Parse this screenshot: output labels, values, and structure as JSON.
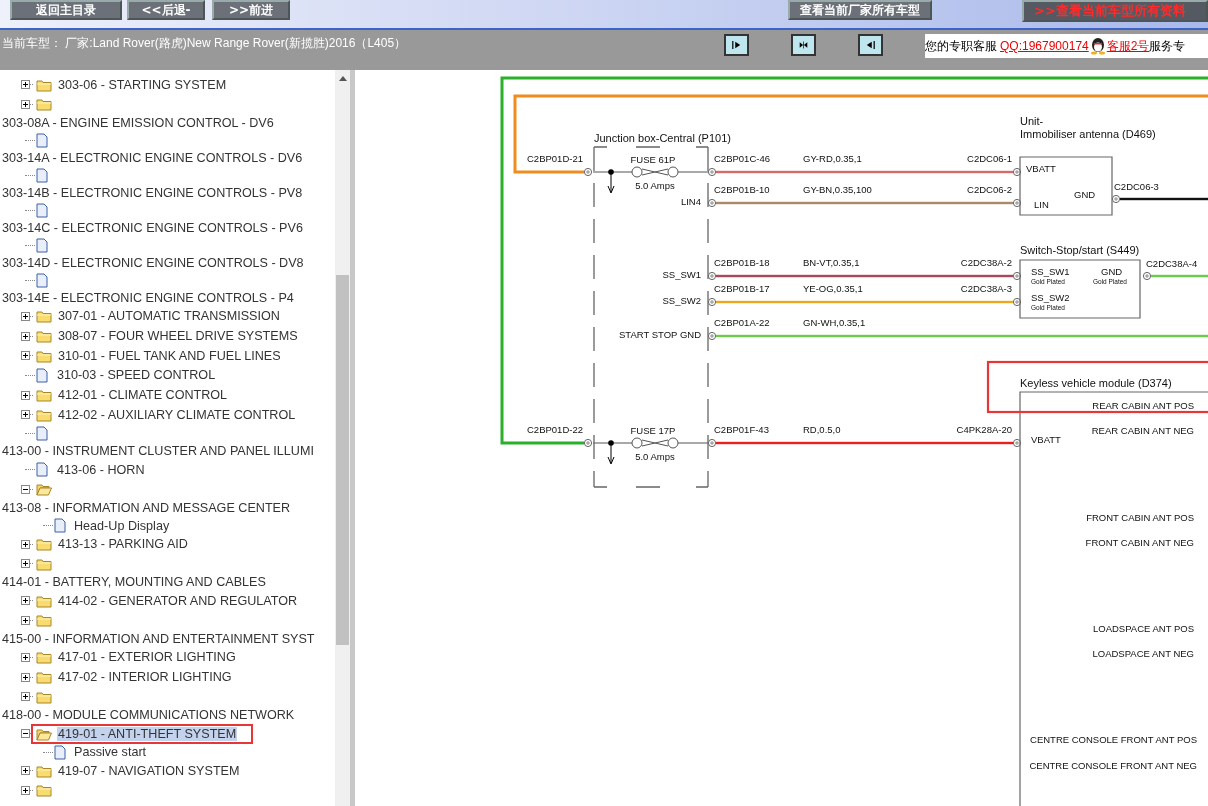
{
  "toolbar": {
    "buttons": [
      {
        "label": "返回主目录",
        "kind": "nav"
      },
      {
        "label": "<<后退-",
        "kind": "nav"
      },
      {
        "label": ">>前进",
        "kind": "nav"
      },
      {
        "label": "查看当前厂家所有车型",
        "kind": "nav"
      },
      {
        "label": ">>查看当前车型所有资料",
        "kind": "highlight"
      }
    ]
  },
  "vehicle_bar": {
    "text": "当前车型： 厂家:Land Rover(路虎)New Range Rover(新揽胜)2016（L405）"
  },
  "support": {
    "prefix": "您的专职客服",
    "qq_link": "QQ:1967900174",
    "agent_link": "客服2号",
    "suffix": "服务专"
  },
  "tree": {
    "rows": [
      {
        "kind": "folder",
        "label": "303-06 - STARTING SYSTEM",
        "expanded": false,
        "selected": false
      },
      {
        "kind": "folder",
        "expanded": false
      },
      {
        "kind": "text",
        "label": "303-08A - ENGINE EMISSION CONTROL - DV6",
        "selected": false
      },
      {
        "kind": "doc"
      },
      {
        "kind": "text",
        "label": "303-14A - ELECTRONIC ENGINE CONTROLS - DV6",
        "selected": false
      },
      {
        "kind": "doc"
      },
      {
        "kind": "text",
        "label": "303-14B - ELECTRONIC ENGINE CONTROLS - PV8",
        "selected": false
      },
      {
        "kind": "doc"
      },
      {
        "kind": "text",
        "label": "303-14C - ELECTRONIC ENGINE CONTROLS - PV6",
        "selected": false
      },
      {
        "kind": "doc"
      },
      {
        "kind": "text",
        "label": "303-14D - ELECTRONIC ENGINE CONTROLS - DV8",
        "selected": false
      },
      {
        "kind": "doc"
      },
      {
        "kind": "text",
        "label": "303-14E - ELECTRONIC ENGINE CONTROLS - P4",
        "selected": false
      },
      {
        "kind": "folder",
        "label": "307-01 - AUTOMATIC TRANSMISSION",
        "expanded": false,
        "selected": false
      },
      {
        "kind": "folder",
        "label": "308-07 - FOUR WHEEL DRIVE SYSTEMS",
        "expanded": false,
        "selected": false
      },
      {
        "kind": "folder",
        "label": "310-01 - FUEL TANK AND FUEL LINES",
        "expanded": false,
        "selected": false
      },
      {
        "kind": "doc",
        "label": "310-03 - SPEED CONTROL",
        "selected": false
      },
      {
        "kind": "folder",
        "label": "412-01 - CLIMATE CONTROL",
        "expanded": false,
        "selected": false
      },
      {
        "kind": "folder",
        "label": "412-02 - AUXILIARY CLIMATE CONTROL",
        "expanded": false,
        "selected": false
      },
      {
        "kind": "doc"
      },
      {
        "kind": "text",
        "label": "413-00 - INSTRUMENT CLUSTER AND PANEL ILLUMI",
        "selected": false
      },
      {
        "kind": "doc",
        "label": "413-06 - HORN",
        "selected": false
      },
      {
        "kind": "folder",
        "expanded": true
      },
      {
        "kind": "text",
        "label": "413-08 - INFORMATION AND MESSAGE CENTER",
        "selected": false,
        "children": [
          {
            "kind": "doc",
            "label": "Head-Up Display",
            "selected": false
          }
        ]
      },
      {
        "kind": "folder",
        "label": "413-13 - PARKING AID",
        "expanded": false,
        "selected": false
      },
      {
        "kind": "folder",
        "expanded": false
      },
      {
        "kind": "text",
        "label": "414-01 - BATTERY, MOUNTING AND CABLES",
        "selected": false
      },
      {
        "kind": "folder",
        "label": "414-02 - GENERATOR AND REGULATOR",
        "expanded": false,
        "selected": false
      },
      {
        "kind": "folder",
        "expanded": false
      },
      {
        "kind": "text",
        "label": "415-00 - INFORMATION AND ENTERTAINMENT SYST",
        "selected": false
      },
      {
        "kind": "folder",
        "label": "417-01 - EXTERIOR LIGHTING",
        "expanded": false,
        "selected": false
      },
      {
        "kind": "folder",
        "label": "417-02 - INTERIOR LIGHTING",
        "expanded": false,
        "selected": false
      },
      {
        "kind": "folder",
        "expanded": false
      },
      {
        "kind": "text",
        "label": "418-00 - MODULE COMMUNICATIONS NETWORK",
        "selected": false
      },
      {
        "kind": "folder",
        "label": "419-01 - ANTI-THEFT SYSTEM",
        "expanded": true,
        "selected": true,
        "annotated": true,
        "children": [
          {
            "kind": "doc",
            "label": "Passive start",
            "selected": false
          }
        ]
      },
      {
        "kind": "folder",
        "label": "419-07 - NAVIGATION SYSTEM",
        "expanded": false,
        "selected": false
      },
      {
        "kind": "folder",
        "expanded": false
      }
    ]
  },
  "diagram": {
    "junction_box": {
      "title": "Junction box-Central (P101)"
    },
    "fuses": [
      {
        "name": "FUSE 61P",
        "rating": "5.0 Amps",
        "input_pin": "C2BP01D-21",
        "color": "#f08c1e"
      },
      {
        "name": "FUSE 17P",
        "rating": "5.0 Amps",
        "input_pin": "C2BP01D-22",
        "color": "#2ab02a"
      }
    ],
    "wires": [
      {
        "from_pin": "C2BP01C-46",
        "spec": "GY-RD,0.35,1",
        "to_pin": "C2DC06-1",
        "color": "#d46a6a"
      },
      {
        "from_label": "LIN4",
        "from_pin": "C2BP01B-10",
        "spec": "GY-BN,0.35,100",
        "to_pin": "C2DC06-2",
        "color": "#a88a6a"
      },
      {
        "from_label": "SS_SW1",
        "from_pin": "C2BP01B-18",
        "spec": "BN-VT,0.35,1",
        "to_pin": "C2DC38A-2",
        "color": "#a84858"
      },
      {
        "from_label": "SS_SW2",
        "from_pin": "C2BP01B-17",
        "spec": "YE-OG,0.35,1",
        "to_pin": "C2DC38A-3",
        "color": "#e8a820"
      },
      {
        "from_label": "START STOP GND",
        "from_pin": "C2BP01A-22",
        "spec": "GN-WH,0.35,1",
        "color": "#6acc4a"
      },
      {
        "from_pin": "C2BP01F-43",
        "spec": "RD,0.5,0",
        "to_pin": "C4PK28A-20",
        "color": "#e82020"
      }
    ],
    "modules": [
      {
        "title": [
          "Unit-",
          "Immobiliser antenna (D469)"
        ],
        "pins": [
          {
            "label": "VBATT"
          },
          {
            "label": "LIN"
          },
          {
            "label": "GND"
          }
        ],
        "output": {
          "pin": "C2DC06-3",
          "color": "#111111"
        }
      },
      {
        "title": [
          "Switch-Stop/start (S449)"
        ],
        "pins": [
          {
            "label": "SS_SW1",
            "note": "Gold Plated"
          },
          {
            "label": "GND",
            "note": "Gold Plated"
          },
          {
            "label": "SS_SW2",
            "note": "Gold Plated"
          }
        ],
        "output": {
          "pin": "C2DC38A-4",
          "color": "#6acc4a"
        }
      },
      {
        "title": [
          "Keyless vehicle module (D374)"
        ],
        "annotated": true,
        "pins": [
          {
            "label": "VBATT"
          },
          {
            "label": "REAR CABIN ANT POS"
          },
          {
            "label": "REAR CABIN ANT NEG"
          },
          {
            "label": "FRONT CABIN ANT POS"
          },
          {
            "label": "FRONT CABIN ANT NEG"
          },
          {
            "label": "LOADSPACE ANT POS"
          },
          {
            "label": "LOADSPACE ANT NEG"
          },
          {
            "label": "CENTRE CONSOLE FRONT ANT POS"
          },
          {
            "label": "CENTRE CONSOLE FRONT ANT NEG"
          }
        ]
      }
    ]
  }
}
